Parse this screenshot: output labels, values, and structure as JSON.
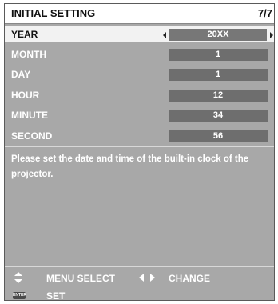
{
  "header": {
    "title": "INITIAL SETTING",
    "page": "7/7"
  },
  "rows": [
    {
      "label": "YEAR",
      "value": "20XX"
    },
    {
      "label": "MONTH",
      "value": "1"
    },
    {
      "label": "DAY",
      "value": "1"
    },
    {
      "label": "HOUR",
      "value": "12"
    },
    {
      "label": "MINUTE",
      "value": "34"
    },
    {
      "label": "SECOND",
      "value": "56"
    }
  ],
  "message": "Please set the date and time of the built-in clock of the projector.",
  "footer": {
    "menu_select": "MENU SELECT",
    "change": "CHANGE",
    "enter_icon_text": "ENTER",
    "set": "SET"
  },
  "icons": {
    "updown": "up-down-arrows-icon",
    "leftright": "left-right-arrows-icon",
    "enter": "enter-button-icon"
  },
  "colors": {
    "panel": "#a8a8a8",
    "value_box": "#6e6e6e",
    "selected_row": "#f2f2f2"
  }
}
